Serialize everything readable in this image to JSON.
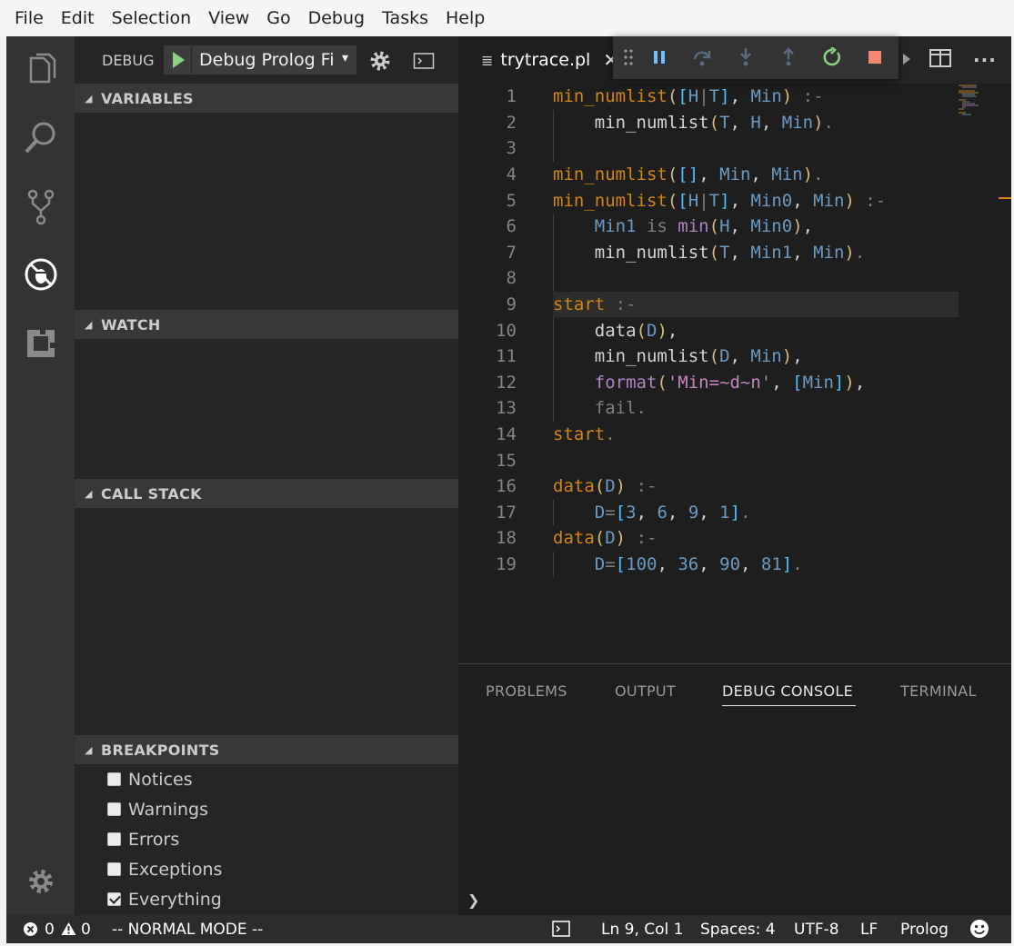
{
  "menu": [
    "File",
    "Edit",
    "Selection",
    "View",
    "Go",
    "Debug",
    "Tasks",
    "Help"
  ],
  "activity": {
    "icons": [
      "explorer-icon",
      "search-icon",
      "source-control-icon",
      "debug-icon",
      "extensions-icon",
      "settings-gear-icon"
    ]
  },
  "debug_toolbar": {
    "label": "DEBUG",
    "config_name": "Debug Prolog Fi",
    "chevron": "▾"
  },
  "sections": {
    "variables": "VARIABLES",
    "watch": "WATCH",
    "call_stack": "CALL STACK",
    "breakpoints": "BREAKPOINTS"
  },
  "breakpoints": [
    {
      "label": "Notices",
      "checked": false
    },
    {
      "label": "Warnings",
      "checked": false
    },
    {
      "label": "Errors",
      "checked": false
    },
    {
      "label": "Exceptions",
      "checked": false
    },
    {
      "label": "Everything",
      "checked": true
    }
  ],
  "editor": {
    "tab_name": "trytrace.pl",
    "tab_icon": "≣",
    "close_glyph": "✕",
    "more_glyph": "···",
    "highlighted_line": 9,
    "lines": [
      "1",
      "2",
      "3",
      "4",
      "5",
      "6",
      "7",
      "8",
      "9",
      "10",
      "11",
      "12",
      "13",
      "14",
      "15",
      "16",
      "17",
      "18",
      "19"
    ]
  },
  "panel": {
    "tabs": [
      "PROBLEMS",
      "OUTPUT",
      "DEBUG CONSOLE",
      "TERMINAL"
    ],
    "active_tab": "DEBUG CONSOLE",
    "prompt": "❯"
  },
  "statusbar": {
    "errors": "0",
    "warnings": "0",
    "mode": "-- NORMAL MODE  --",
    "position": "Ln 9, Col 1",
    "spaces": "Spaces: 4",
    "encoding": "UTF-8",
    "eol": "LF",
    "language": "Prolog"
  },
  "colors": {
    "accent_orange": "#d18616",
    "blue_value": "#6c9ac2",
    "bracket_yellow": "#d7ba7d",
    "status_bar": "#2c2c2c",
    "run_green": "#89d185",
    "stop_red": "#f48771"
  }
}
